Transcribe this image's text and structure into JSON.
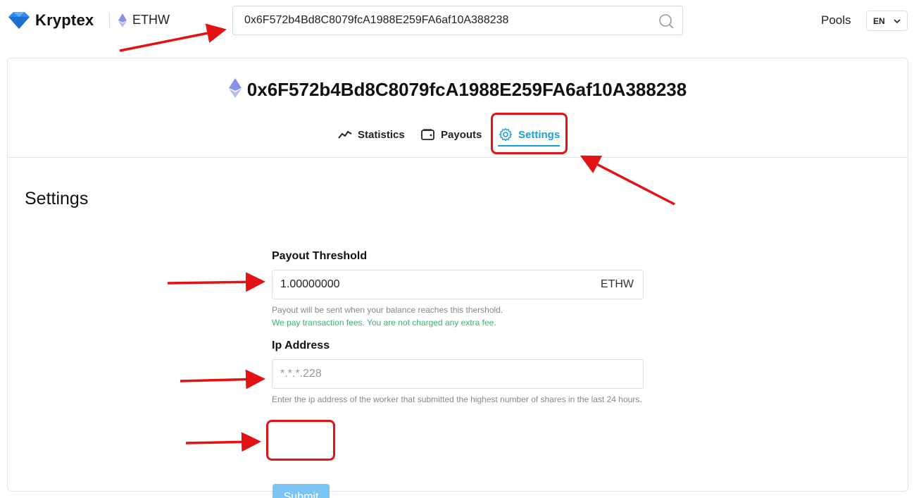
{
  "header": {
    "brand": "Kryptex",
    "coin": "ETHW",
    "search_value": "0x6F572b4Bd8C8079fcA1988E259FA6af10A388238",
    "nav_pools": "Pools",
    "language": "EN"
  },
  "wallet": {
    "address": "0x6F572b4Bd8C8079fcA1988E259FA6af10A388238",
    "tabs": [
      {
        "label": "Statistics",
        "icon": "chart-line-icon"
      },
      {
        "label": "Payouts",
        "icon": "wallet-icon"
      },
      {
        "label": "Settings",
        "icon": "gear-icon",
        "active": true
      }
    ]
  },
  "settings": {
    "title": "Settings",
    "payout_threshold": {
      "label": "Payout Threshold",
      "value": "1.00000000",
      "unit": "ETHW",
      "hint": "Payout will be sent when your balance reaches this thershold.",
      "fee_note": "We pay transaction fees. You are not charged any extra fee."
    },
    "ip_address": {
      "label": "Ip Address",
      "placeholder": "*.*.*.228",
      "hint": "Enter the ip address of the worker that submitted the highest number of shares in the last 24 hours."
    },
    "submit_label": "Submit"
  },
  "colors": {
    "accent": "#1aa0d8",
    "submit": "#7bc5f5",
    "success_text": "#3db16b",
    "annotation": "#e31313"
  }
}
